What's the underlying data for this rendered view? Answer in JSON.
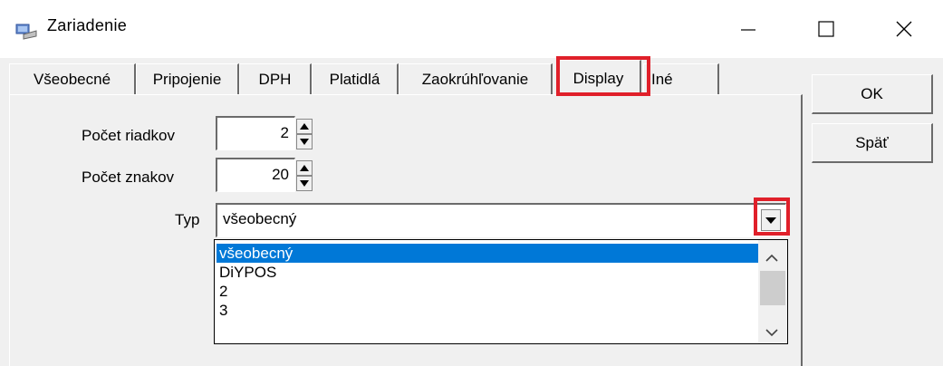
{
  "window": {
    "title": "Zariadenie",
    "controls": {
      "minimize": "—",
      "maximize": "☐",
      "close": "✕"
    }
  },
  "tabs": [
    {
      "label": "Všeobecné",
      "active": false
    },
    {
      "label": "Pripojenie",
      "active": false
    },
    {
      "label": "DPH",
      "active": false
    },
    {
      "label": "Platidlá",
      "active": false
    },
    {
      "label": "Zaokrúhľovanie",
      "active": false
    },
    {
      "label": "Display",
      "active": true
    },
    {
      "label": "Iné",
      "active": false
    }
  ],
  "form": {
    "rows_label": "Počet riadkov",
    "rows_value": "2",
    "chars_label": "Počet znakov",
    "chars_value": "20",
    "type_label": "Typ",
    "type_value": "všeobecný",
    "type_options": [
      "všeobecný",
      "DiYPOS",
      "2",
      "3"
    ],
    "type_selected_index": 0
  },
  "buttons": {
    "ok": "OK",
    "back": "Späť"
  },
  "colors": {
    "highlight": "#e0202a",
    "selection": "#0078d7"
  }
}
